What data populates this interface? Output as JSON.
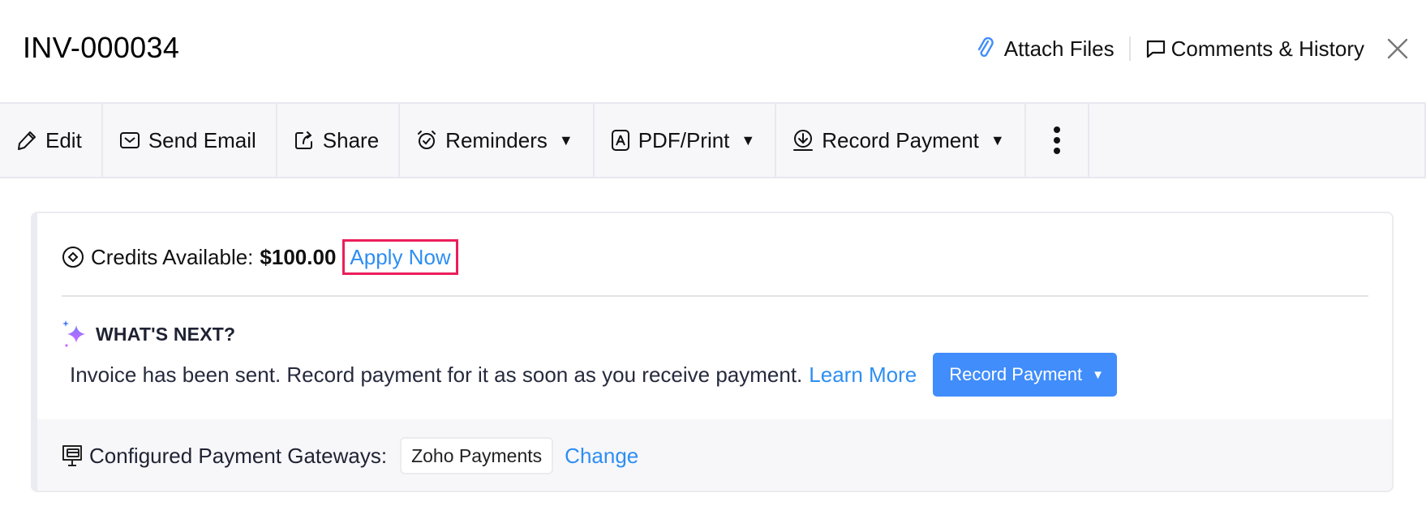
{
  "header": {
    "title": "INV-000034",
    "attach_files": "Attach Files",
    "comments_history": "Comments & History",
    "icons": {
      "attach": "paperclip-icon",
      "comments": "chat-bubble-icon",
      "close": "close-icon"
    }
  },
  "toolbar": {
    "items": [
      {
        "label": "Edit",
        "icon": "pencil-icon",
        "dropdown": false
      },
      {
        "label": "Send Email",
        "icon": "envelope-icon",
        "dropdown": false
      },
      {
        "label": "Share",
        "icon": "share-icon",
        "dropdown": false
      },
      {
        "label": "Reminders",
        "icon": "alarm-clock-icon",
        "dropdown": true
      },
      {
        "label": "PDF/Print",
        "icon": "pdf-icon",
        "dropdown": true
      },
      {
        "label": "Record Payment",
        "icon": "download-circle-icon",
        "dropdown": true
      }
    ],
    "more_icon": "more-vertical-icon",
    "caret": "▼"
  },
  "card": {
    "credits": {
      "label": "Credits Available:",
      "amount": "$100.00",
      "apply_now": "Apply Now"
    },
    "whats_next": {
      "title": "WHAT'S NEXT?",
      "message": "Invoice has been sent. Record payment for it as soon as you receive payment.",
      "learn_more": "Learn More",
      "record_payment_button": "Record Payment",
      "caret": "▼"
    },
    "gateways": {
      "label": "Configured Payment Gateways:",
      "gateway": "Zoho Payments",
      "change": "Change"
    }
  },
  "colors": {
    "accent_blue": "#408dfb",
    "link_blue": "#2d8ef2",
    "highlight_border": "#eb1e5a",
    "toolbar_bg": "#f7f7fa"
  }
}
